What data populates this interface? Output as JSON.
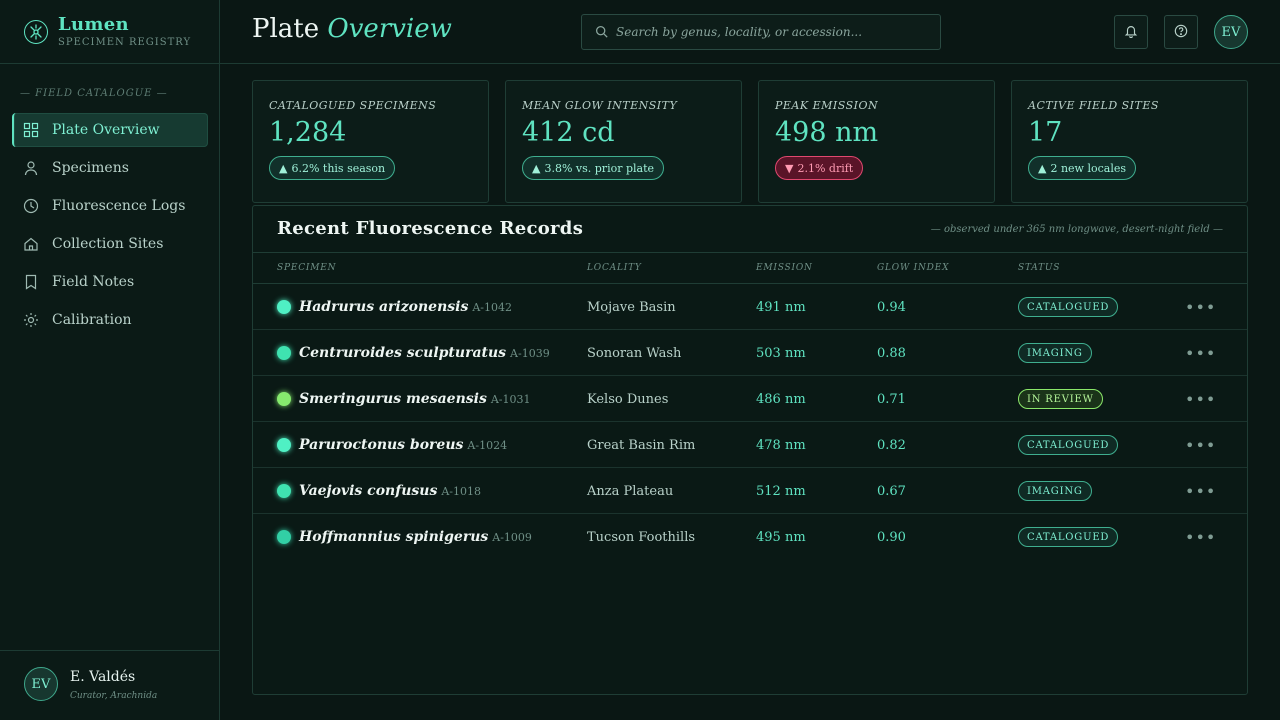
{
  "brand": {
    "name": "Lumen",
    "subtitle": "SPECIMEN REGISTRY"
  },
  "sidebar": {
    "section_label": "— FIELD CATALOGUE —",
    "items": [
      {
        "label": "Plate Overview",
        "icon": "grid-icon",
        "active": true
      },
      {
        "label": "Specimens",
        "icon": "person-icon"
      },
      {
        "label": "Fluorescence Logs",
        "icon": "clock-icon"
      },
      {
        "label": "Collection Sites",
        "icon": "home-icon"
      },
      {
        "label": "Field Notes",
        "icon": "bookmark-icon"
      },
      {
        "label": "Calibration",
        "icon": "sun-icon"
      }
    ]
  },
  "user": {
    "initials": "EV",
    "name": "E. Valdés",
    "role": "Curator, Arachnida"
  },
  "header": {
    "title": "Plate",
    "title_accent": "Overview",
    "search_placeholder": "Search by genus, locality, or accession...",
    "avatar_initials": "EV"
  },
  "kpis": [
    {
      "label": "CATALOGUED SPECIMENS",
      "value": "1,284",
      "delta": "6.2% this season",
      "trend": "up"
    },
    {
      "label": "MEAN GLOW INTENSITY",
      "value": "412 cd",
      "delta": "3.8% vs. prior plate",
      "trend": "up"
    },
    {
      "label": "PEAK EMISSION",
      "value": "498 nm",
      "delta": "2.1% drift",
      "trend": "down"
    },
    {
      "label": "ACTIVE FIELD SITES",
      "value": "17",
      "delta": "2 new locales",
      "trend": "up"
    }
  ],
  "records": {
    "title": "Recent Fluorescence Records",
    "note": "— observed under 365 nm longwave, desert-night field —",
    "columns": [
      "SPECIMEN",
      "LOCALITY",
      "EMISSION",
      "GLOW INDEX",
      "STATUS"
    ],
    "rows": [
      {
        "name": "Hadrurus arizonensis",
        "accession": "A-1042",
        "locality": "Mojave Basin",
        "emission": "491 nm",
        "glow": "0.94",
        "status": "CATALOGUED",
        "dot_color": "#4ff0c4"
      },
      {
        "name": "Centruroides sculpturatus",
        "accession": "A-1039",
        "locality": "Sonoran Wash",
        "emission": "503 nm",
        "glow": "0.88",
        "status": "IMAGING",
        "dot_color": "#3fe2b0"
      },
      {
        "name": "Smeringurus mesaensis",
        "accession": "A-1031",
        "locality": "Kelso Dunes",
        "emission": "486 nm",
        "glow": "0.71",
        "status": "IN REVIEW",
        "dot_color": "#86ea6e"
      },
      {
        "name": "Paruroctonus boreus",
        "accession": "A-1024",
        "locality": "Great Basin Rim",
        "emission": "478 nm",
        "glow": "0.82",
        "status": "CATALOGUED",
        "dot_color": "#4ff0c4"
      },
      {
        "name": "Vaejovis confusus",
        "accession": "A-1018",
        "locality": "Anza Plateau",
        "emission": "512 nm",
        "glow": "0.67",
        "status": "IMAGING",
        "dot_color": "#3fe2b0"
      },
      {
        "name": "Hoffmannius spinigerus",
        "accession": "A-1009",
        "locality": "Tucson Foothills",
        "emission": "495 nm",
        "glow": "0.90",
        "status": "CATALOGUED",
        "dot_color": "#32cfa5"
      }
    ]
  }
}
